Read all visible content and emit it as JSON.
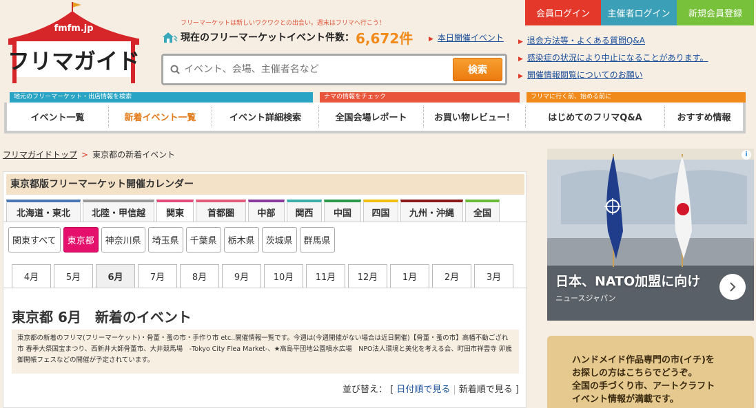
{
  "header": {
    "logo_sub": "fmfm.jp",
    "logo_main": "フリマガイド",
    "tagline": "フリーマーケットは新しいワクワクとの出会い。週末はフリマへ行こう！",
    "count_label": "現在のフリーマーケットイベント件数：",
    "count_value": "6,672件",
    "today_link": "本日開催イベント",
    "search": {
      "placeholder": "イベント、会場、主催者名など",
      "button": "検索"
    },
    "auth": {
      "member_login": "会員ログイン",
      "host_login": "主催者ログイン",
      "register": "新規会員登録"
    },
    "links": [
      "退会方法等・よくある質問Q&A",
      "感染症の状況により中止になることがあります。",
      "開催情報閲覧についてのお願い"
    ]
  },
  "nav": {
    "labels": [
      "地元のフリーマーケット・出店情報を検索",
      "ナマの情報をチェック",
      "フリマに行く前、始める前に"
    ],
    "label_colors": [
      "#2aa4c4",
      "#e8553a",
      "#f08a1a"
    ],
    "items": [
      "イベント一覧",
      "新着イベント一覧",
      "イベント詳細検索",
      "全国会場レポート",
      "お買い物レビュー！",
      "はじめてのフリマQ&A",
      "おすすめ情報"
    ],
    "active_index": 1
  },
  "breadcrumb": {
    "home": "フリマガイドトップ",
    "sep": ">",
    "current": "東京都の新着イベント"
  },
  "calendar": {
    "title": "東京都版フリーマーケット開催カレンダー",
    "regions": [
      {
        "label": "北海道・東北",
        "color": "#4a78b5"
      },
      {
        "label": "北陸・甲信越",
        "color": "#999999"
      },
      {
        "label": "関東",
        "color": "#e34c7a"
      },
      {
        "label": "首都圏",
        "color": "#e35a7a"
      },
      {
        "label": "中部",
        "color": "#8a3a9c"
      },
      {
        "label": "関西",
        "color": "#3ab0a8"
      },
      {
        "label": "中国",
        "color": "#2a9a4a"
      },
      {
        "label": "四国",
        "color": "#f0c010"
      },
      {
        "label": "九州・沖縄",
        "color": "#8a1a1a"
      },
      {
        "label": "全国",
        "color": "#6aba3a"
      }
    ],
    "active_region": 2,
    "prefectures": [
      "関東すべて",
      "東京都",
      "神奈川県",
      "埼玉県",
      "千葉県",
      "栃木県",
      "茨城県",
      "群馬県"
    ],
    "active_pref": 1,
    "months": [
      "4月",
      "5月",
      "6月",
      "7月",
      "8月",
      "9月",
      "10月",
      "11月",
      "12月",
      "1月",
      "2月",
      "3月"
    ],
    "active_month": 2
  },
  "event": {
    "heading": "東京都 6月　新着のイベント",
    "description": "東京都の新着のフリマ(フリーマーケット)・骨董・蚤の市・手作り市 etc..開催情報一覧です。今週は(今週開催がない場合は近日開催)【骨董・蚤の市】高幡不動ござれ市 春季大祭国宝まつり、西新井大師骨董市、大井競馬場　-Tokyo City Flea Market-、★高島平団地公園噴水広場　NPO法人環境と美化を考える会、町田市祥雲寺 卯歳御開帳フェスなどの開催が予定されています。",
    "sort_label": "並び替え：",
    "sort_open": "[",
    "sort_by_date": "日付順で見る",
    "sort_by_new": "新着順で見る",
    "sort_close": "]"
  },
  "ad": {
    "title": "日本、NATO加盟に向け",
    "source": "ニュースジャパン",
    "info": "i"
  },
  "banner": {
    "lines": [
      "ハンドメイド作品専門の市(イチ)を",
      "お探しの方はこちらでどうぞ。",
      "全国の手づくり市、アートクラフト",
      "イベント情報が満載です。"
    ]
  }
}
